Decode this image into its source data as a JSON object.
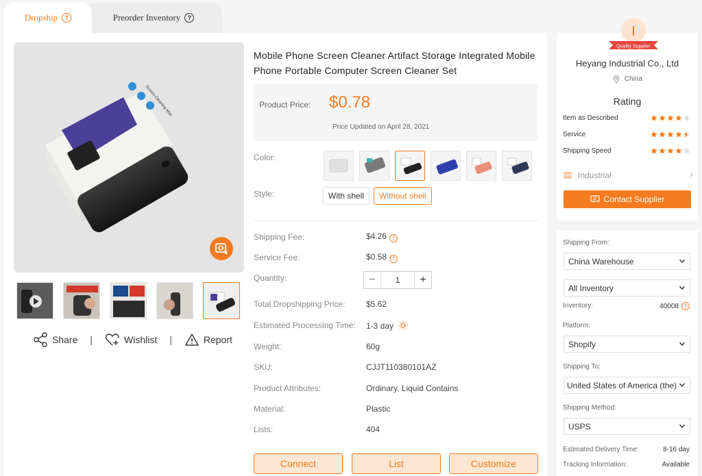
{
  "tabs": {
    "dropship": "Dropship",
    "preorder": "Preorder Inventory"
  },
  "product": {
    "title": "Mobile Phone Screen Cleaner Artifact Storage Integrated Mobile Phone Portable Computer Screen Cleaner Set",
    "price_label": "Product Price:",
    "price": "$0.78",
    "price_updated": "Price Updated on April 28, 2021",
    "color_label": "Color:",
    "style_label": "Style:",
    "styles": [
      "With shell",
      "Without shell"
    ],
    "selected_style": "Without shell",
    "shipping_fee_label": "Shipping Fee:",
    "shipping_fee": "$4.26",
    "service_fee_label": "Service Fee:",
    "service_fee": "$0.58",
    "quantity_label": "Quantity:",
    "quantity": "1",
    "total_label": "Total Dropshipping Price:",
    "total": "$5.62",
    "processing_label": "Estimated Processing Time:",
    "processing": "1-3 day",
    "weight_label": "Weight:",
    "weight": "60g",
    "sku_label": "SKU:",
    "sku": "CJJT110380101AZ",
    "attributes_label": "Product Attributes:",
    "attributes": "Ordinary, Liquid Contains",
    "material_label": "Material:",
    "material": "Plastic",
    "lists_label": "Lists:",
    "lists": "404"
  },
  "gallery": {
    "share": "Share",
    "wishlist": "Wishlist",
    "report": "Report",
    "separator": "|",
    "box_text": "Screen Cleaning Mist"
  },
  "buttons": {
    "connect": "Connect",
    "list": "List",
    "customize": "Customize"
  },
  "supplier": {
    "badge_letter": "I",
    "badge_ribbon": "Quality Supplier",
    "name": "Heyang Industrial Co., Ltd",
    "location": "China",
    "rating_title": "Rating",
    "ratings": [
      {
        "label": "Item as Described",
        "stars": 4
      },
      {
        "label": "Service",
        "stars": 4.5
      },
      {
        "label": "Shipping Speed",
        "stars": 4
      }
    ],
    "category": "Industrial",
    "contact": "Contact Supplier"
  },
  "shipping": {
    "from_label": "Shipping From:",
    "from": "China Warehouse",
    "inventory_select": "All Inventory",
    "inventory_label": "Inventory:",
    "inventory": "40008",
    "platform_label": "Platform:",
    "platform": "Shopify",
    "to_label": "Shipping To:",
    "to": "United States of America (the)",
    "method_label": "Shipping Method:",
    "method": "USPS",
    "delivery_label": "Estimated Delivery Time:",
    "delivery": "8-16 day",
    "tracking_label": "Tracking Information:",
    "tracking": "Available"
  },
  "colors": {
    "accent": "#f47b20",
    "accent_light": "#fde7d3",
    "badge_red": "#e8453c"
  }
}
